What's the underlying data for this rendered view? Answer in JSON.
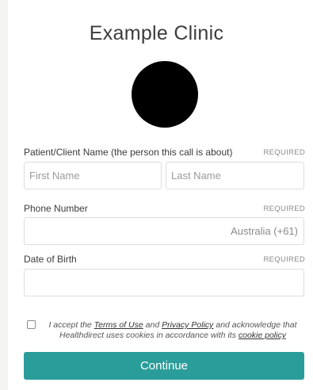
{
  "clinic": {
    "name": "Example Clinic"
  },
  "patient": {
    "label": "Patient/Client Name (the person this call is about)",
    "required": "REQUIRED",
    "first_name_placeholder": "First Name",
    "last_name_placeholder": "Last Name"
  },
  "phone": {
    "label": "Phone Number",
    "required": "REQUIRED",
    "country": "Australia (+61)"
  },
  "dob": {
    "label": "Date of Birth",
    "required": "REQUIRED"
  },
  "terms": {
    "text_1": "I accept the ",
    "terms_link": "Terms of Use",
    "text_2": " and ",
    "privacy_link": "Privacy Policy",
    "text_3": " and acknowledge that Healthdirect uses cookies in accordance with its ",
    "cookie_link": "cookie policy"
  },
  "actions": {
    "continue_label": "Continue"
  },
  "colors": {
    "accent": "#2a9d9a",
    "background": "#f4f4f2"
  }
}
